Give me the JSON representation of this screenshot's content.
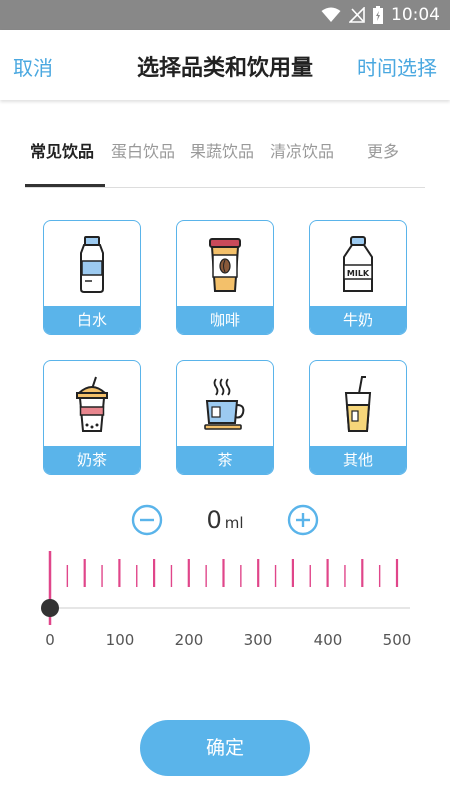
{
  "status_bar": {
    "time": "10:04"
  },
  "header": {
    "cancel_label": "取消",
    "title": "选择品类和饮用量",
    "time_select_label": "时间选择"
  },
  "tabs": [
    {
      "label": "常见饮品",
      "active": true
    },
    {
      "label": "蛋白饮品",
      "active": false
    },
    {
      "label": "果蔬饮品",
      "active": false
    },
    {
      "label": "清凉饮品",
      "active": false
    },
    {
      "label": "更多",
      "active": false
    }
  ],
  "drinks": [
    {
      "label": "白水",
      "icon": "water-bottle-icon"
    },
    {
      "label": "咖啡",
      "icon": "coffee-cup-icon"
    },
    {
      "label": "牛奶",
      "icon": "milk-bottle-icon"
    },
    {
      "label": "奶茶",
      "icon": "milk-tea-icon"
    },
    {
      "label": "茶",
      "icon": "tea-cup-icon"
    },
    {
      "label": "其他",
      "icon": "juice-glass-icon"
    }
  ],
  "amount": {
    "value": "0",
    "unit": "ml"
  },
  "ruler": {
    "min": 0,
    "max": 500,
    "current": 0,
    "labels": [
      "0",
      "100",
      "200",
      "300",
      "400",
      "500"
    ],
    "accent_color": "#e0468a"
  },
  "colors": {
    "accent": "#5ab4ea",
    "title_link": "#4aa8e0",
    "ruler_tick": "#e0468a"
  },
  "confirm_label": "确定"
}
